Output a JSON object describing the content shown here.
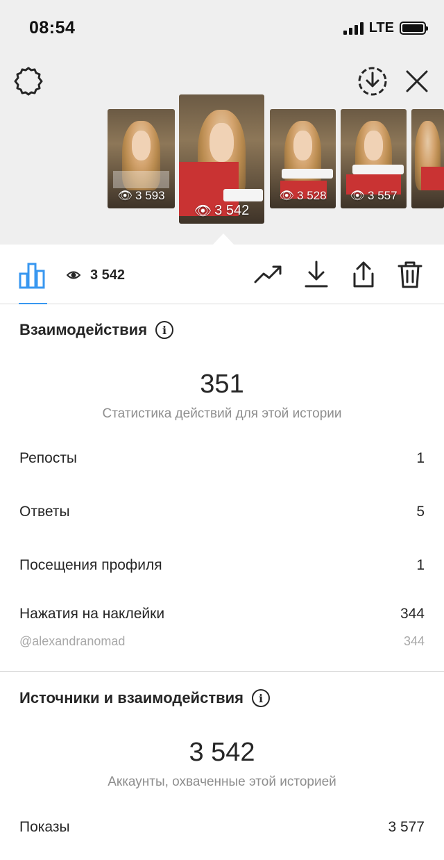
{
  "status_bar": {
    "time": "08:54",
    "network": "LTE",
    "battery_level": 1.0
  },
  "top_icons": {
    "settings": "gear-icon",
    "download": "download-circle-icon",
    "close": "close-icon"
  },
  "stories": [
    {
      "views": "3 593",
      "selected": false
    },
    {
      "views": "3 542",
      "selected": true
    },
    {
      "views": "3 528",
      "selected": false
    },
    {
      "views": "3 557",
      "selected": false
    },
    {
      "views": "",
      "selected": false
    }
  ],
  "toolbar": {
    "view_count": "3 542",
    "icons": [
      "bar-chart-icon",
      "eye-icon",
      "trend-icon",
      "download-icon",
      "share-icon",
      "trash-icon"
    ],
    "accent": "#3897f0"
  },
  "interactions": {
    "title": "Взаимодействия",
    "total": "351",
    "subtitle": "Статистика действий для этой истории",
    "rows": [
      {
        "label": "Репосты",
        "value": "1"
      },
      {
        "label": "Ответы",
        "value": "5"
      },
      {
        "label": "Посещения профиля",
        "value": "1"
      },
      {
        "label": "Нажатия на наклейки",
        "value": "344"
      }
    ],
    "sticker": {
      "label": "@alexandranomad",
      "value": "344"
    }
  },
  "discovery": {
    "title": "Источники и взаимодействия",
    "total": "3 542",
    "subtitle": "Аккаунты, охваченные этой историей",
    "rows": [
      {
        "label": "Показы",
        "value": "3 577"
      }
    ]
  }
}
